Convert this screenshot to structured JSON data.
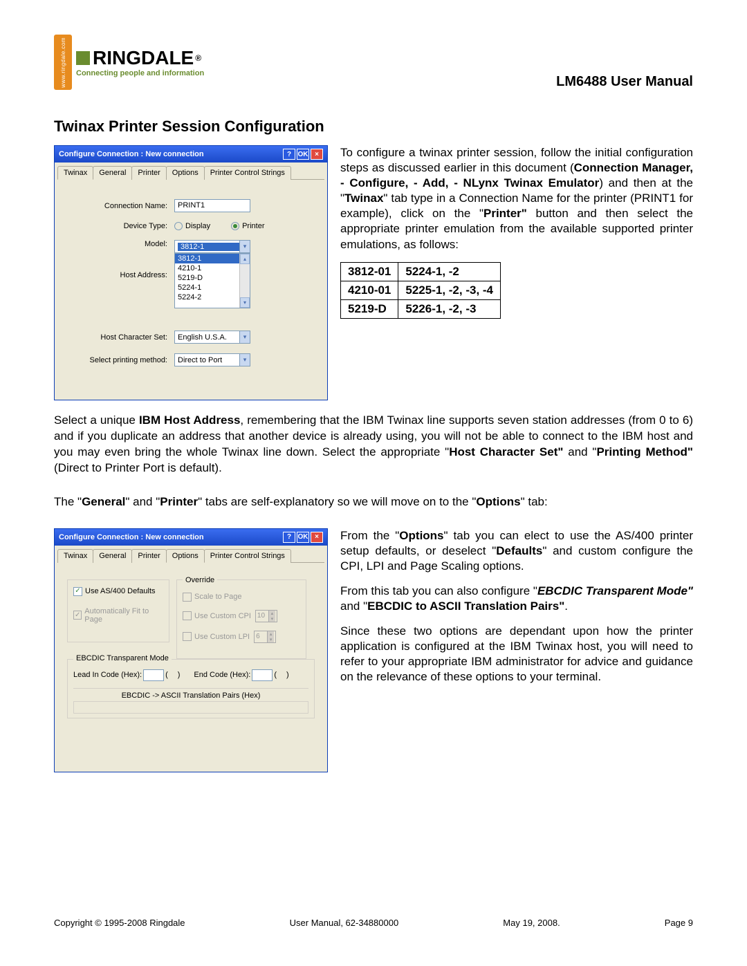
{
  "header": {
    "orange_tab_text": "www.ringdale.com",
    "logo_main": "RINGDALE",
    "logo_reg": "®",
    "logo_sub": "Connecting people and information",
    "doc_title": "LM6488 User Manual"
  },
  "section_title": "Twinax Printer Session Configuration",
  "dialog1": {
    "title": "Configure Connection : New connection",
    "help_btn": "?",
    "ok_btn": "OK",
    "close_btn": "×",
    "tabs": [
      "Twinax",
      "General",
      "Printer",
      "Options",
      "Printer Control Strings"
    ],
    "active_tab": 0,
    "fields": {
      "connection_name_label": "Connection Name:",
      "connection_name_value": "PRINT1",
      "device_type_label": "Device Type:",
      "display": "Display",
      "printer": "Printer",
      "model_label": "Model:",
      "model_selected": "3812-1",
      "model_list": [
        "3812-1",
        "4210-1",
        "5219-D",
        "5224-1",
        "5224-2"
      ],
      "host_address_label": "Host Address:",
      "host_charset_label": "Host Character Set:",
      "host_charset_value": "English U.S.A.",
      "print_method_label": "Select printing method:",
      "print_method_value": "Direct to Port"
    }
  },
  "para1_parts": {
    "t1": "To configure a twinax printer session, follow the initial configuration steps as discussed earlier in this document (",
    "b1": "Connection Manager, - Configure, - Add, - NLynx Twinax Emulator",
    "t2": ") and then at the \"",
    "b2": "Twinax",
    "t3": "\" tab type in a Connection Name for the printer (PRINT1 for example), click on the \"",
    "b3": "Printer\"",
    "t4": " button and then select the appropriate printer emulation from the available supported printer emulations, as follows:"
  },
  "emul_table": [
    [
      "3812-01",
      "5224-1, -2"
    ],
    [
      "4210-01",
      "5225-1, -2, -3, -4"
    ],
    [
      "5219-D",
      "5226-1, -2, -3"
    ]
  ],
  "para2_parts": {
    "t1": "Select a unique ",
    "b1": "IBM Host Address",
    "t2": ", remembering that the IBM Twinax line supports seven station addresses (from 0 to 6) and if you duplicate an address that another device is already using, you will not be able to connect to the IBM host and you may even bring the whole Twinax line down.  Select the appropriate \"",
    "b2": "Host Character Set\"",
    "t3": " and \"",
    "b3": "Printing Method\"",
    "t4": " (Direct to Printer Port is default)."
  },
  "para3_parts": {
    "t1": "The \"",
    "b1": "General",
    "t2": "\" and \"",
    "b2": "Printer",
    "t3": "\" tabs are self-explanatory so we will move on to the \"",
    "b3": "Options",
    "t4": "\" tab:"
  },
  "dialog2": {
    "title": "Configure Connection : New connection",
    "tabs": [
      "Twinax",
      "General",
      "Printer",
      "Options",
      "Printer Control Strings"
    ],
    "active_tab": 3,
    "left": {
      "use_defaults": "Use AS/400 Defaults",
      "auto_fit": "Automatically Fit to Page"
    },
    "right": {
      "group_label": "Override",
      "scale_to_page": "Scale to Page",
      "use_cpi": "Use Custom CPI",
      "cpi_val": "10",
      "use_lpi": "Use Custom LPI",
      "lpi_val": "6"
    },
    "bottom": {
      "group_label": "EBCDIC Transparent Mode",
      "lead_in": "Lead In Code (Hex):",
      "end_code": "End Code (Hex):",
      "paren_open": "(",
      "paren_close": ")",
      "trans_label": "EBCDIC -> ASCII Translation Pairs (Hex)"
    }
  },
  "para4_parts": {
    "t1": "From the \"",
    "b1": "Options",
    "t2": "\" tab you can elect to use the AS/400 printer setup defaults, or deselect \"",
    "b2": "Defaults",
    "t3": "\" and custom configure the CPI, LPI and Page Scaling options."
  },
  "para5_parts": {
    "t1": "From this tab you can also configure \"",
    "bi1": "EBCDIC Transparent Mode\"",
    "t2": " and \"",
    "b1": "EBCDIC to ASCII Translation Pairs\"",
    "t3": "."
  },
  "para6": "Since these two options are dependant upon how the printer application is configured at the IBM Twinax host, you will need to refer to your appropriate IBM administrator for advice and guidance on the relevance of these options to your terminal.",
  "footer": {
    "copyright": "Copyright © 1995-2008 Ringdale",
    "manual": "User Manual, 62-34880000",
    "date": "May 19, 2008.",
    "page": "Page 9"
  }
}
